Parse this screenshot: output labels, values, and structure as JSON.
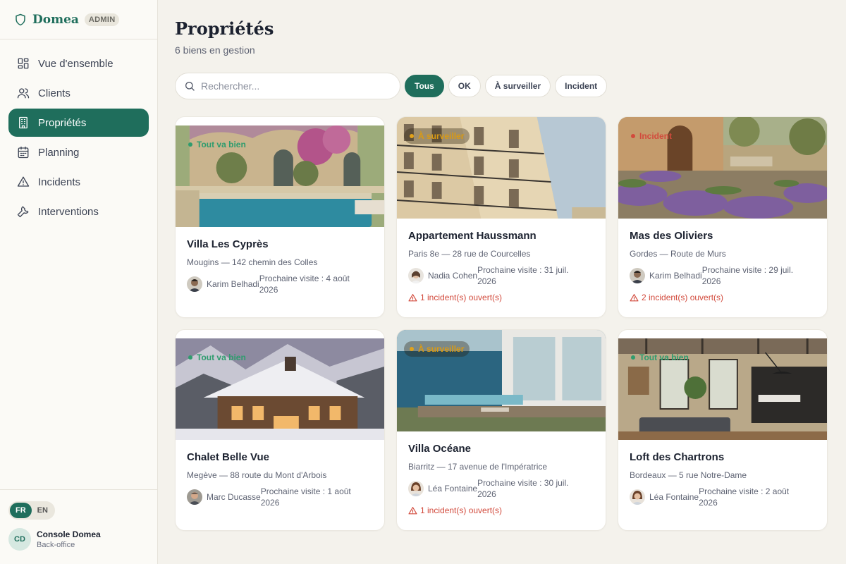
{
  "brand": {
    "name": "Domea",
    "badge": "ADMIN",
    "icon": "shield-icon"
  },
  "nav": [
    {
      "label": "Vue d'ensemble",
      "icon": "dashboard-icon"
    },
    {
      "label": "Clients",
      "icon": "users-icon"
    },
    {
      "label": "Propriétés",
      "icon": "building-icon",
      "active": true
    },
    {
      "label": "Planning",
      "icon": "calendar-icon"
    },
    {
      "label": "Incidents",
      "icon": "warning-icon"
    },
    {
      "label": "Interventions",
      "icon": "wrench-icon"
    }
  ],
  "footer": {
    "lang_fr": "FR",
    "lang_en": "EN",
    "user_initials": "CD",
    "user_name": "Console Domea",
    "user_role": "Back-office"
  },
  "page": {
    "title": "Propriétés",
    "subtitle": "6 biens en gestion"
  },
  "search": {
    "placeholder": "Rechercher..."
  },
  "filters": [
    "Tous",
    "OK",
    "À surveiller",
    "Incident"
  ],
  "colors": {
    "accent": "#1f6e5c",
    "ok": "#2f9c6e",
    "warn": "#e2a21a",
    "incident": "#d24a3c",
    "background": "#f4f2ec"
  },
  "properties": [
    {
      "status": "Tout va bien",
      "name": "Villa Les Cyprès",
      "address": "Mougins — 142 chemin des Colles",
      "manager": "Karim Belhadi",
      "visit_line1": "Prochaine visite : 4 août",
      "visit_line2": "2026",
      "incident": ""
    },
    {
      "status": "À surveiller",
      "name": "Appartement Haussmann",
      "address": "Paris 8e — 28 rue de Courcelles",
      "manager": "Nadia Cohen",
      "visit_line1": "Prochaine visite : 31 juil.",
      "visit_line2": "2026",
      "incident": "1 incident(s) ouvert(s)"
    },
    {
      "status": "Incident",
      "name": "Mas des Oliviers",
      "address": "Gordes — Route de Murs",
      "manager": "Karim Belhadi",
      "visit_line1": "Prochaine visite : 29 juil.",
      "visit_line2": "2026",
      "incident": "2 incident(s) ouvert(s)"
    },
    {
      "status": "Tout va bien",
      "name": "Chalet Belle Vue",
      "address": "Megève — 88 route du Mont d'Arbois",
      "manager": "Marc Ducasse",
      "visit_line1": "Prochaine visite : 1 août",
      "visit_line2": "2026",
      "incident": ""
    },
    {
      "status": "À surveiller",
      "name": "Villa Océane",
      "address": "Biarritz — 17 avenue de l'Impératrice",
      "manager": "Léa Fontaine",
      "visit_line1": "Prochaine visite : 30 juil.",
      "visit_line2": "2026",
      "incident": "1 incident(s) ouvert(s)"
    },
    {
      "status": "Tout va bien",
      "name": "Loft des Chartrons",
      "address": "Bordeaux — 5 rue Notre-Dame",
      "manager": "Léa Fontaine",
      "visit_line1": "Prochaine visite : 2 août",
      "visit_line2": "2026",
      "incident": ""
    }
  ]
}
